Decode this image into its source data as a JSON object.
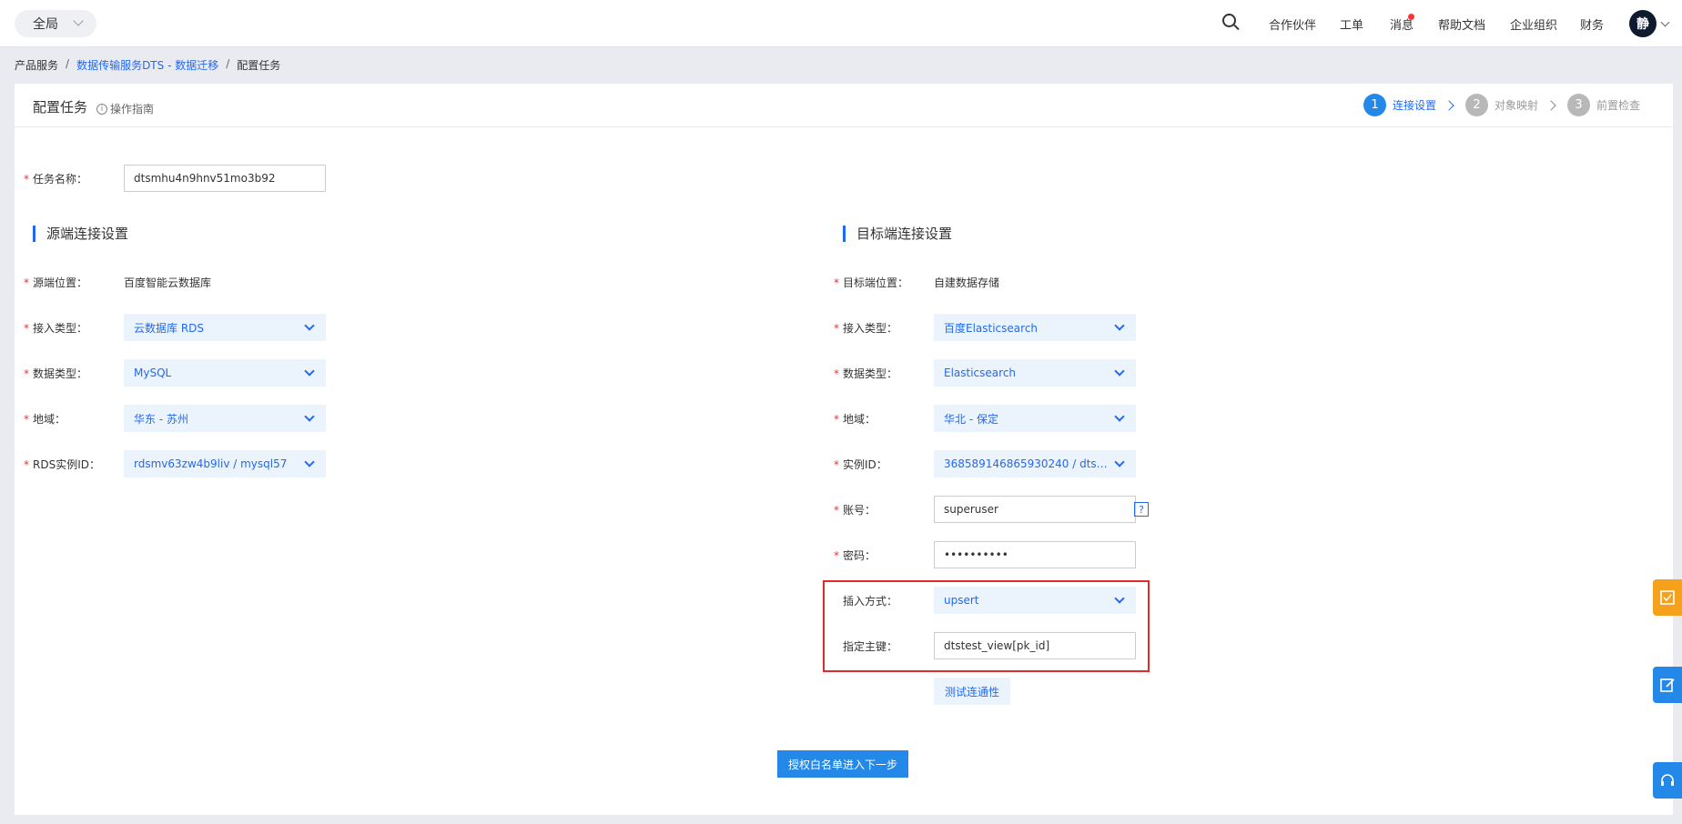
{
  "topbar": {
    "scope_label": "全局",
    "nav_items": [
      "合作伙伴",
      "工单",
      "消息",
      "帮助文档",
      "企业组织",
      "财务"
    ],
    "avatar_text": "静"
  },
  "breadcrumb": {
    "items": [
      "产品服务",
      "数据传输服务DTS - 数据迁移",
      "配置任务"
    ],
    "separator": "/"
  },
  "header": {
    "title": "配置任务",
    "guide_label": "操作指南",
    "steps": [
      {
        "num": "1",
        "label": "连接设置",
        "active": true
      },
      {
        "num": "2",
        "label": "对象映射",
        "active": false
      },
      {
        "num": "3",
        "label": "前置检查",
        "active": false
      }
    ]
  },
  "task": {
    "name_label": "任务名称：",
    "name_value": "dtsmhu4n9hnv51mo3b92"
  },
  "source": {
    "section_title": "源端连接设置",
    "location_label": "源端位置：",
    "location_value": "百度智能云数据库",
    "access_type_label": "接入类型：",
    "access_type_value": "云数据库 RDS",
    "data_type_label": "数据类型：",
    "data_type_value": "MySQL",
    "region_label": "地域：",
    "region_value": "华东 - 苏州",
    "instance_label": "RDS实例ID：",
    "instance_value": "rdsmv63zw4b9liv / mysql57"
  },
  "target": {
    "section_title": "目标端连接设置",
    "location_label": "目标端位置：",
    "location_value": "自建数据存储",
    "access_type_label": "接入类型：",
    "access_type_value": "百度Elasticsearch",
    "data_type_label": "数据类型：",
    "data_type_value": "Elasticsearch",
    "region_label": "地域：",
    "region_value": "华北 - 保定",
    "instance_label": "实例ID：",
    "instance_value": "368589146865930240 / dtstest...",
    "account_label": "账号：",
    "account_value": "superuser",
    "password_label": "密码：",
    "password_value": "••••••••••",
    "insert_mode_label": "插入方式：",
    "insert_mode_value": "upsert",
    "primary_key_label": "指定主键：",
    "primary_key_value": "dtstest_view[pk_id]",
    "help_glyph": "?"
  },
  "buttons": {
    "test_connection": "测试连通性",
    "next": "授权白名单进入下一步"
  },
  "colors": {
    "accent": "#2468f2",
    "primary_button": "#2488e8",
    "highlight_border": "#e32a2a",
    "float_orange": "#f5a11b"
  },
  "icons": {
    "search": "search-icon",
    "feedback": "feedback-icon",
    "edit": "edit-icon",
    "support": "headset-icon"
  }
}
